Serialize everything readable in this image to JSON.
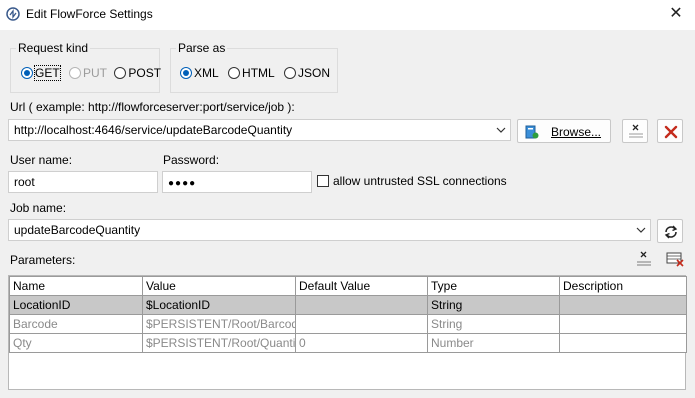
{
  "window": {
    "title": "Edit FlowForce Settings"
  },
  "request_kind": {
    "label": "Request kind",
    "options": [
      {
        "label": "GET",
        "state": "checked"
      },
      {
        "label": "PUT",
        "state": "disabled"
      },
      {
        "label": "POST",
        "state": "unchecked"
      }
    ]
  },
  "parse_as": {
    "label": "Parse as",
    "options": [
      {
        "label": "XML",
        "state": "checked"
      },
      {
        "label": "HTML",
        "state": "unchecked"
      },
      {
        "label": "JSON",
        "state": "unchecked"
      }
    ]
  },
  "url": {
    "label": "Url ( example: http://flowforceserver:port/service/job ):",
    "value": "http://localhost:4646/service/updateBarcodeQuantity",
    "browse_label": "Browse..."
  },
  "credentials": {
    "user_label": "User name:",
    "user_value": "root",
    "password_label": "Password:",
    "password_value": "●●●●",
    "ssl_label": "allow untrusted SSL connections"
  },
  "job": {
    "label": "Job name:",
    "value": "updateBarcodeQuantity"
  },
  "parameters": {
    "label": "Parameters:",
    "columns": [
      "Name",
      "Value",
      "Default Value",
      "Type",
      "Description"
    ],
    "rows": [
      {
        "name": "LocationID",
        "value": "$LocationID",
        "default": "",
        "type": "String",
        "description": ""
      },
      {
        "name": "Barcode",
        "value": "$PERSISTENT/Root/Barcode",
        "default": "",
        "type": "String",
        "description": ""
      },
      {
        "name": "Qty",
        "value": "$PERSISTENT/Root/Quantity",
        "default": "0",
        "type": "Number",
        "description": ""
      }
    ]
  },
  "colors": {
    "accent": "#005fb8",
    "delete_red": "#c42b1c",
    "selected_row": "#c8c8c8"
  }
}
